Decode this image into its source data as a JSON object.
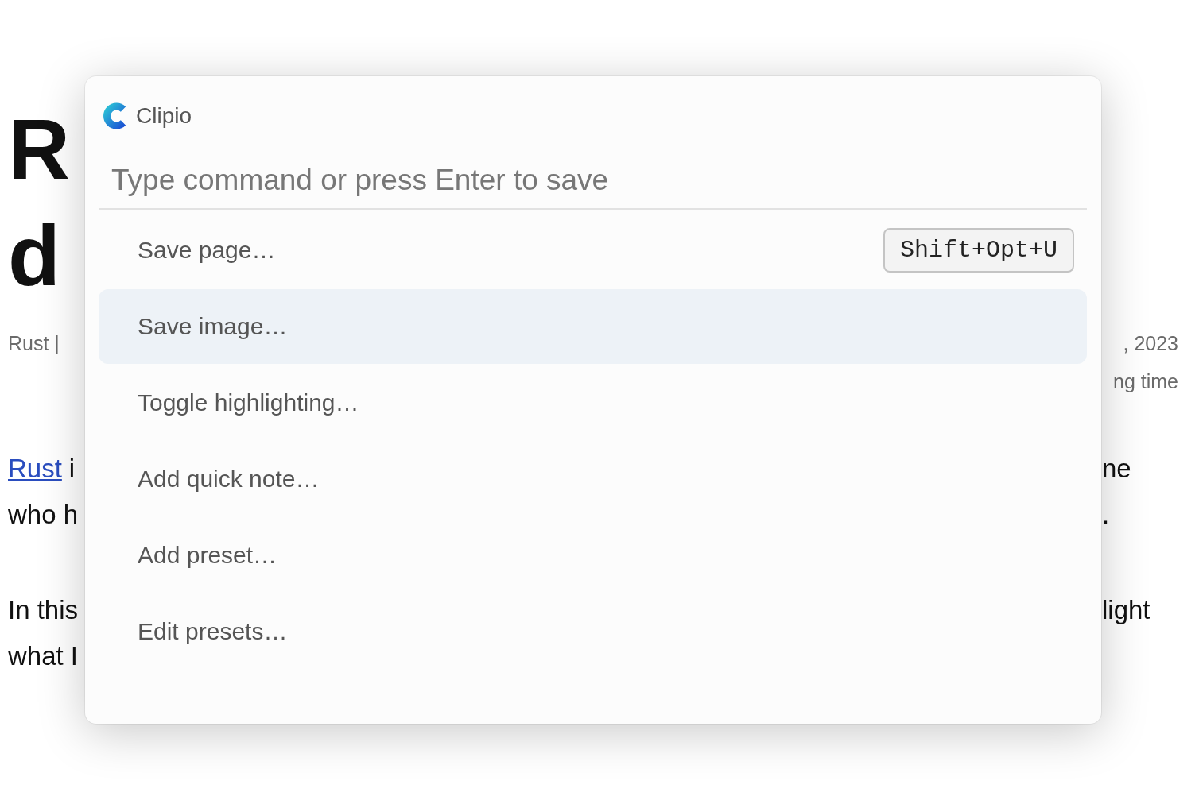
{
  "background_page": {
    "title_lines": [
      "R",
      "d"
    ],
    "meta_left": "Rust |",
    "meta_right": [
      ", 2023",
      "ng time"
    ],
    "paragraph_left": [
      {
        "link": "Rust",
        "text": "i"
      },
      {
        "text": "who h"
      },
      {
        "text": "In this"
      },
      {
        "text": "what I"
      }
    ],
    "paragraph_right": [
      "ne",
      ".",
      "light"
    ]
  },
  "palette": {
    "app": {
      "name": "Clipio"
    },
    "command_field": {
      "placeholder": "Type command or press Enter to save"
    },
    "commands": [
      {
        "label": "Save page…",
        "shortcut": "Shift+Opt+U",
        "selected": false
      },
      {
        "label": "Save image…",
        "selected": true
      },
      {
        "label": "Toggle highlighting…",
        "selected": false
      },
      {
        "label": "Add quick note…",
        "selected": false
      },
      {
        "label": "Add preset…",
        "selected": false
      },
      {
        "label": "Edit presets…",
        "selected": false
      }
    ]
  }
}
